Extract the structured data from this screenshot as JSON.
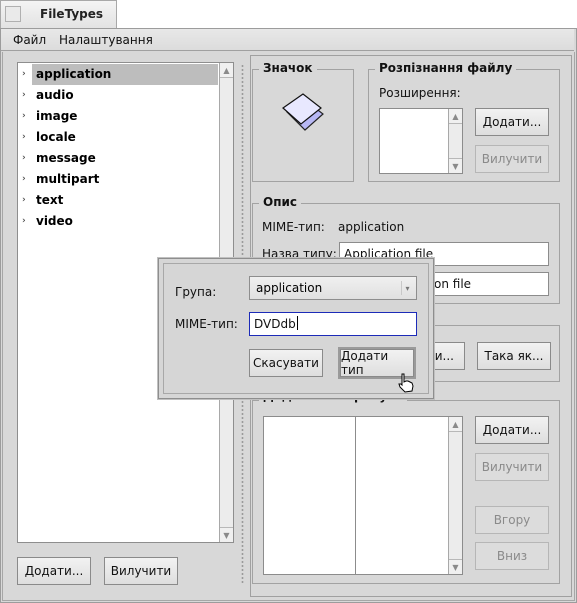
{
  "window": {
    "title": "FileTypes"
  },
  "menubar": {
    "items": [
      {
        "label": "Файл"
      },
      {
        "label": "Налаштування"
      }
    ]
  },
  "tree": {
    "selected": "application",
    "items": [
      {
        "label": "application",
        "expand_icon": "chevron-right-icon"
      },
      {
        "label": "audio",
        "expand_icon": "chevron-right-icon"
      },
      {
        "label": "image",
        "expand_icon": "chevron-right-icon"
      },
      {
        "label": "locale",
        "expand_icon": "chevron-right-icon"
      },
      {
        "label": "message",
        "expand_icon": "chevron-right-icon"
      },
      {
        "label": "multipart",
        "expand_icon": "chevron-right-icon"
      },
      {
        "label": "text",
        "expand_icon": "chevron-right-icon"
      },
      {
        "label": "video",
        "expand_icon": "chevron-right-icon"
      }
    ],
    "add_button": "Додати...",
    "remove_button": "Вилучити"
  },
  "icon_group": {
    "title": "Значок",
    "icon": "generic-file-icon"
  },
  "recognition_group": {
    "title": "Розпізнання файлу",
    "extensions_label": "Розширення:",
    "add_button": "Додати...",
    "remove_button": "Вилучити"
  },
  "description_group": {
    "title": "Опис",
    "mime_label": "MIME-тип:",
    "mime_value": "application",
    "type_name_label": "Назва типу:",
    "type_name_value": "Application file",
    "description_value_visible": "on file"
  },
  "app_group": {
    "partial_button": "ти...",
    "same_as_button": "Така як..."
  },
  "attributes_group": {
    "title": "Додаткові атрибути",
    "add_button": "Додати...",
    "remove_button": "Вилучити",
    "up_button": "Вгору",
    "down_button": "Вниз"
  },
  "dialog": {
    "group_label": "Група:",
    "group_value": "application",
    "mime_label": "MIME-тип:",
    "mime_value": "DVDdb",
    "cancel_button": "Скасувати",
    "add_type_button": "Додати тип"
  },
  "colors": {
    "selection": "#bdbdbd",
    "focus_border": "#1c2bb8",
    "window_bg": "#d8d8d8"
  }
}
